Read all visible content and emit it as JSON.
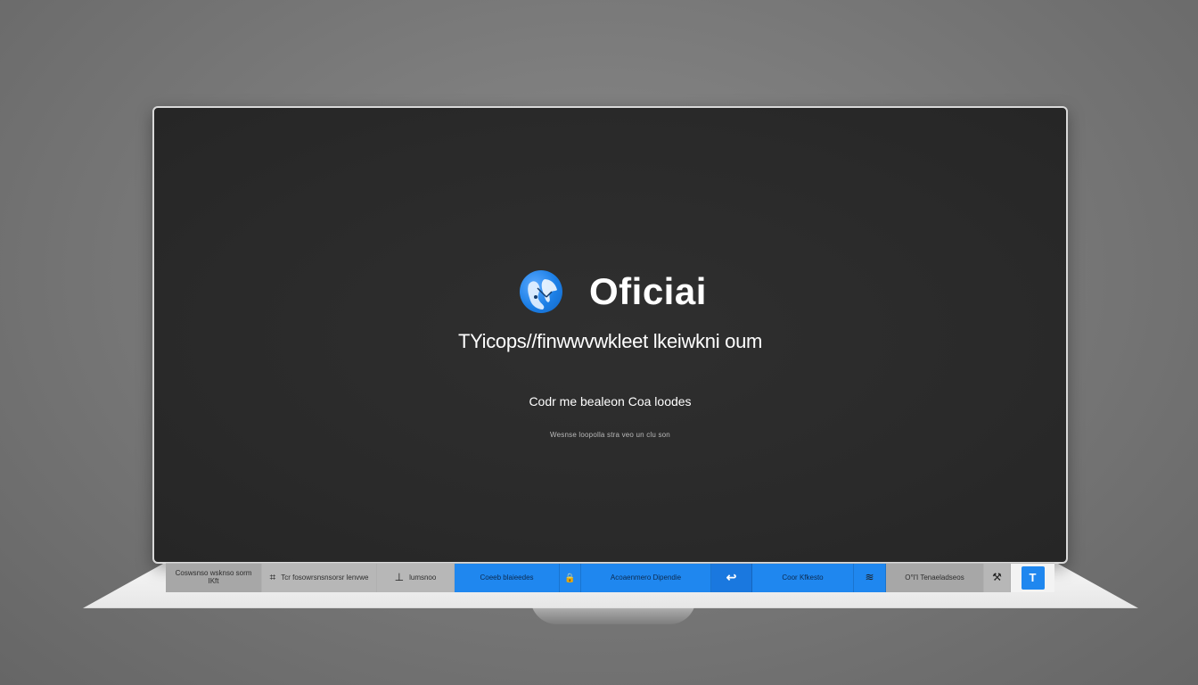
{
  "screen": {
    "brand_name": "Oficiai",
    "url_text": "TYicops//finwwvwkleet lkeiwkni oum",
    "sub_text": "Codr me bealeon Coa loodes",
    "tiny_text": "Wesnse loopolla stra veo un clu son"
  },
  "taskbar": {
    "items": [
      {
        "label": "Coswsnso wsknso sorm\nIKft",
        "style": "gray",
        "icon": ""
      },
      {
        "label": "Tcr fosowrsnsnsorsr lenvwe",
        "style": "gray-light",
        "icon": "hash-icon",
        "glyph": "⌗"
      },
      {
        "label": "lumsnoo",
        "style": "gray-light",
        "icon": "pin-icon",
        "glyph": "⊥"
      },
      {
        "label": "Coeeb blaieedes",
        "style": "blue",
        "icon": ""
      },
      {
        "label": "",
        "style": "blue",
        "icon": "lock-icon",
        "glyph": "🔒"
      },
      {
        "label": "Acoaenmero Dipendie",
        "style": "blue",
        "icon": ""
      },
      {
        "label": "",
        "style": "blue-dark",
        "icon": "arrow-icon",
        "glyph": "↩"
      },
      {
        "label": "Coor Kfkesto",
        "style": "blue",
        "icon": ""
      },
      {
        "label": "",
        "style": "blue",
        "icon": "wave-icon",
        "glyph": "≋"
      },
      {
        "label": "O°l'I Tenaeladseos",
        "style": "gray",
        "icon": ""
      },
      {
        "label": "",
        "style": "gray-light",
        "icon": "tools-icon",
        "glyph": "⚒"
      },
      {
        "label": "",
        "style": "white",
        "icon": "t-icon",
        "glyph": "T"
      }
    ]
  },
  "colors": {
    "accent": "#1f87ef",
    "screen_bg": "#2a2a2a",
    "page_bg": "#7a7a7a"
  }
}
